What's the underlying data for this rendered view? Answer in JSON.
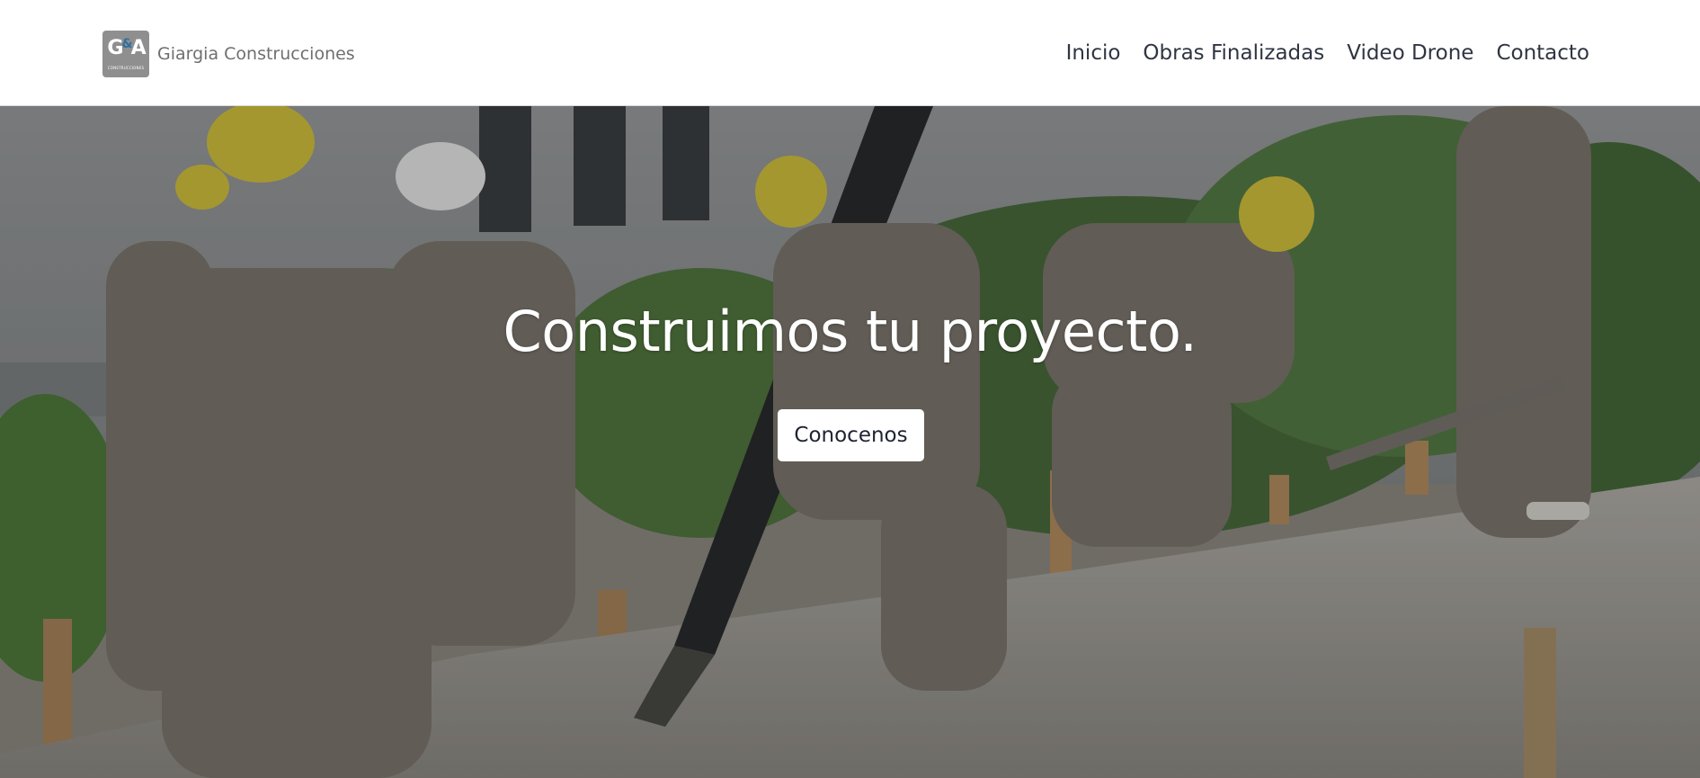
{
  "brand": {
    "logo_letters_left": "G",
    "logo_letters_amp": "&",
    "logo_letters_right": "A",
    "logo_subtext": "CONSTRUCCIONES",
    "name": "Giargia Construcciones"
  },
  "nav": {
    "items": [
      {
        "label": "Inicio"
      },
      {
        "label": "Obras Finalizadas"
      },
      {
        "label": "Video Drone"
      },
      {
        "label": "Contacto"
      }
    ]
  },
  "hero": {
    "title": "Construimos tu proyecto.",
    "button_label": "Conocenos"
  },
  "colors": {
    "nav_text": "#2f3542",
    "brand_text": "#6f6f6f",
    "logo_bg": "#8f8f8f",
    "button_bg": "#ffffff",
    "hero_text": "#ffffff"
  }
}
